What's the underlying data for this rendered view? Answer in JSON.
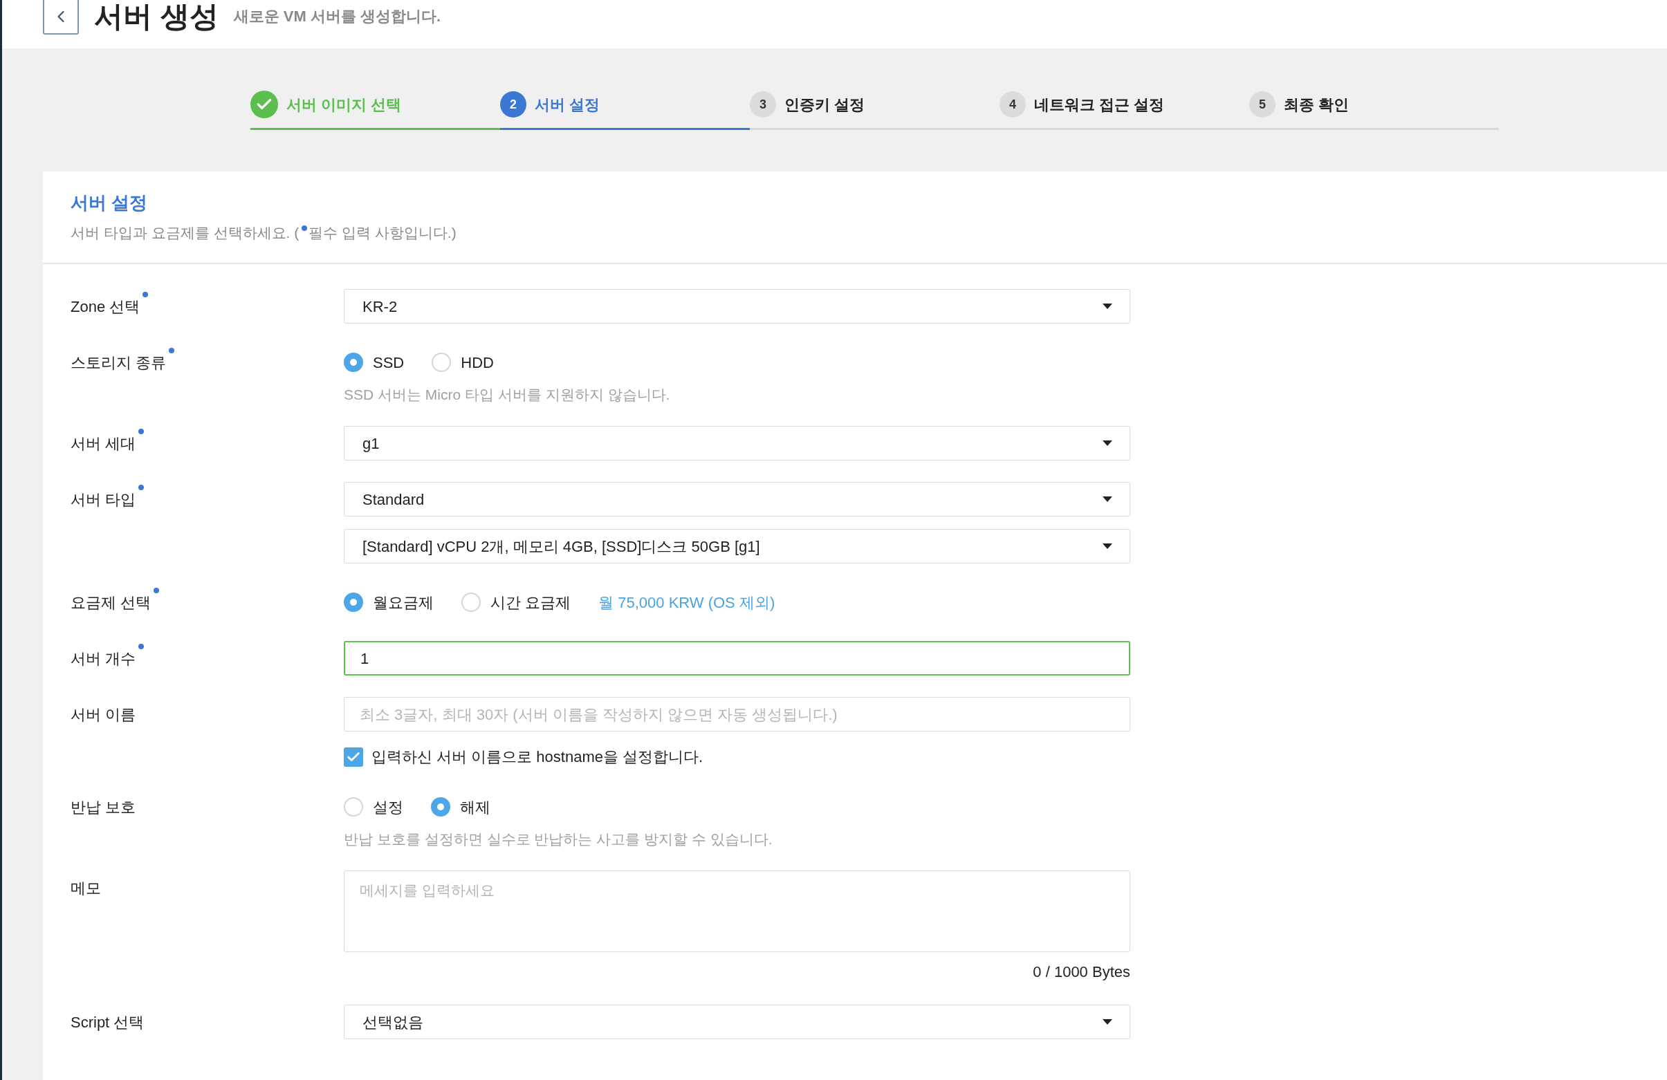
{
  "header": {
    "title": "서버 생성",
    "subtitle": "새로운 VM 서버를 생성합니다."
  },
  "steps": [
    {
      "label": "서버 이미지 선택",
      "completed": true,
      "selected": false
    },
    {
      "number": "2",
      "label": "서버 설정",
      "completed": false,
      "selected": true
    },
    {
      "number": "3",
      "label": "인증키 설정",
      "completed": false,
      "selected": false
    },
    {
      "number": "4",
      "label": "네트워크 접근 설정",
      "completed": false,
      "selected": false
    },
    {
      "number": "5",
      "label": "최종 확인",
      "completed": false,
      "selected": false
    }
  ],
  "section": {
    "title": "서버 설정",
    "description_before": "서버 타입과 요금제를 선택하세요. (",
    "description_after": "필수 입력 사항입니다.)"
  },
  "fields": [
    {
      "label": "Zone 선택",
      "required": true,
      "kind": "select",
      "selects": [
        {
          "value": "KR-2"
        }
      ]
    },
    {
      "label": "스토리지 종류",
      "required": true,
      "kind": "radio",
      "options": [
        {
          "label": "SSD",
          "selected": true
        },
        {
          "label": "HDD",
          "selected": false
        }
      ],
      "hint": "SSD 서버는 Micro 타입 서버를 지원하지 않습니다."
    },
    {
      "label": "서버 세대",
      "required": true,
      "kind": "select",
      "selects": [
        {
          "value": "g1"
        }
      ]
    },
    {
      "label": "서버 타입",
      "required": true,
      "kind": "select",
      "selects": [
        {
          "value": "Standard"
        },
        {
          "value": "[Standard] vCPU 2개, 메모리 4GB, [SSD]디스크 50GB [g1]"
        }
      ]
    },
    {
      "label": "요금제 선택",
      "required": true,
      "kind": "radio",
      "options": [
        {
          "label": "월요금제",
          "selected": true
        },
        {
          "label": "시간 요금제",
          "selected": false
        }
      ],
      "price": "월 75,000 KRW (OS 제외)"
    },
    {
      "label": "서버 개수",
      "required": true,
      "kind": "input",
      "value": "1",
      "focused": true
    },
    {
      "label": "서버 이름",
      "required": false,
      "kind": "input",
      "placeholder": "최소 3글자, 최대 30자 (서버 이름을 작성하지 않으면 자동 생성됩니다.)",
      "focused": false,
      "checkbox": {
        "label": "입력하신 서버 이름으로 hostname을 설정합니다.",
        "checked": true
      }
    },
    {
      "label": "반납 보호",
      "required": false,
      "kind": "radio",
      "options": [
        {
          "label": "설정",
          "selected": false
        },
        {
          "label": "해제",
          "selected": true
        }
      ],
      "hint": "반납 보호를 설정하면 실수로 반납하는 사고를 방지할 수 있습니다."
    },
    {
      "label": "메모",
      "required": false,
      "kind": "textarea",
      "placeholder": "메세지를 입력하세요",
      "counter": "0 / 1000 Bytes"
    },
    {
      "label": "Script 선택",
      "required": false,
      "kind": "select",
      "selects": [
        {
          "value": "선택없음"
        }
      ]
    }
  ]
}
